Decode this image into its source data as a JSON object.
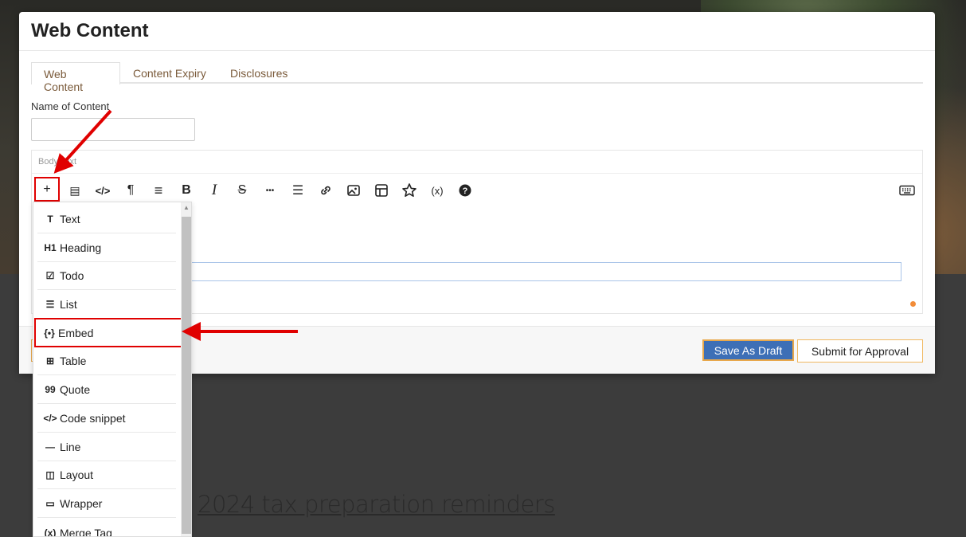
{
  "modal": {
    "title": "Web Content",
    "tabs": [
      {
        "label": "Web Content",
        "active": true
      },
      {
        "label": "Content Expiry",
        "active": false
      },
      {
        "label": "Disclosures",
        "active": false
      }
    ],
    "name_label": "Name of Content",
    "name_value": "",
    "editor_label": "Body Text",
    "toolbar": [
      {
        "icon": "plus-icon",
        "glyph": "+"
      },
      {
        "icon": "block-layout-icon",
        "glyph": "▤"
      },
      {
        "icon": "code-icon",
        "glyph": "</>"
      },
      {
        "icon": "paragraph-icon",
        "glyph": "¶"
      },
      {
        "icon": "align-icon",
        "glyph": "≡"
      },
      {
        "icon": "bold-icon",
        "glyph": "B"
      },
      {
        "icon": "italic-icon",
        "glyph": "I"
      },
      {
        "icon": "strikethrough-icon",
        "glyph": "S"
      },
      {
        "icon": "more-icon",
        "glyph": "•••"
      },
      {
        "icon": "list-icon",
        "glyph": "☰"
      },
      {
        "icon": "link-icon",
        "glyph": "🔗"
      },
      {
        "icon": "image-icon",
        "glyph": "🖼"
      },
      {
        "icon": "table-icon",
        "glyph": "⊞"
      },
      {
        "icon": "star-icon",
        "glyph": "☆"
      },
      {
        "icon": "variable-icon",
        "glyph": "(x)"
      },
      {
        "icon": "help-icon",
        "glyph": "?"
      }
    ],
    "keyboard_icon": "keyboard-icon",
    "buttons": {
      "save_draft": "Save As Draft",
      "submit": "Submit for Approval"
    }
  },
  "menu": {
    "items": [
      {
        "icon": "T",
        "label": "Text"
      },
      {
        "icon": "H1",
        "label": "Heading"
      },
      {
        "icon": "☑",
        "label": "Todo"
      },
      {
        "icon": "☰",
        "label": "List"
      },
      {
        "icon": "{•}",
        "label": "Embed"
      },
      {
        "icon": "⊞",
        "label": "Table"
      },
      {
        "icon": "99",
        "label": "Quote"
      },
      {
        "icon": "</>",
        "label": "Code snippet"
      },
      {
        "icon": "—",
        "label": "Line"
      },
      {
        "icon": "◫",
        "label": "Layout"
      },
      {
        "icon": "▭",
        "label": "Wrapper"
      },
      {
        "icon": "(x)",
        "label": "Merge Tag"
      }
    ],
    "highlighted": "Embed"
  },
  "background": {
    "headline": "2024 tax preparation reminders"
  },
  "colors": {
    "accent_brown": "#7a5a3a",
    "primary_blue": "#3d6fb6",
    "annotation_red": "#e00000",
    "orange": "#f28c38"
  }
}
